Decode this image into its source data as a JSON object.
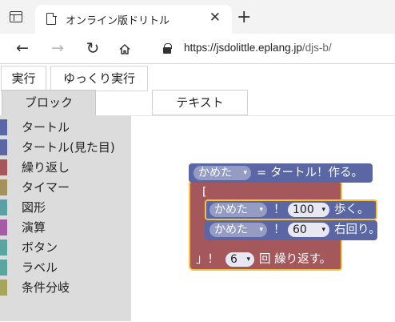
{
  "browser": {
    "tab_title": "オンライン版ドリトル",
    "tab_close": "✕",
    "new_tab": "+",
    "url_host": "https://jsdolittle.eplang.jp",
    "url_path": "/djs-b/",
    "back": "←",
    "forward": "→",
    "reload": "↻"
  },
  "toolbar": {
    "run_label": "実行",
    "slow_run_label": "ゆっくり実行"
  },
  "tabs": {
    "block_label": "ブロック",
    "text_label": "テキスト"
  },
  "palette": {
    "categories": [
      {
        "label": "タートル",
        "color": "#5b67a5"
      },
      {
        "label": "タートル(見た目)",
        "color": "#5b67a5"
      },
      {
        "label": "繰り返し",
        "color": "#a5585b"
      },
      {
        "label": "タイマー",
        "color": "#a5925b"
      },
      {
        "label": "図形",
        "color": "#5ba0a5"
      },
      {
        "label": "演算",
        "color": "#a55ba5"
      },
      {
        "label": "ボタン",
        "color": "#5ba5a0"
      },
      {
        "label": "ラベル",
        "color": "#5ba5a0"
      },
      {
        "label": "条件分岐",
        "color": "#a5a55b"
      }
    ]
  },
  "program": {
    "create_var": "かめた",
    "create_eq": "=",
    "create_text": "タートル！作る。",
    "loop_open": "[",
    "loop_close": "」！",
    "loop_count": "6",
    "loop_text": "回 繰り返す。",
    "walk_var": "かめた",
    "walk_bang": "！",
    "walk_value": "100",
    "walk_text": "歩く。",
    "turn_var": "かめた",
    "turn_bang": "！",
    "turn_value": "60",
    "turn_text": "右回り。",
    "dropdown_arrow": "▾",
    "colors": {
      "turtle_block": "#5b67a5",
      "loop_block": "#a5585b",
      "loop_outline": "#f5c242"
    }
  }
}
